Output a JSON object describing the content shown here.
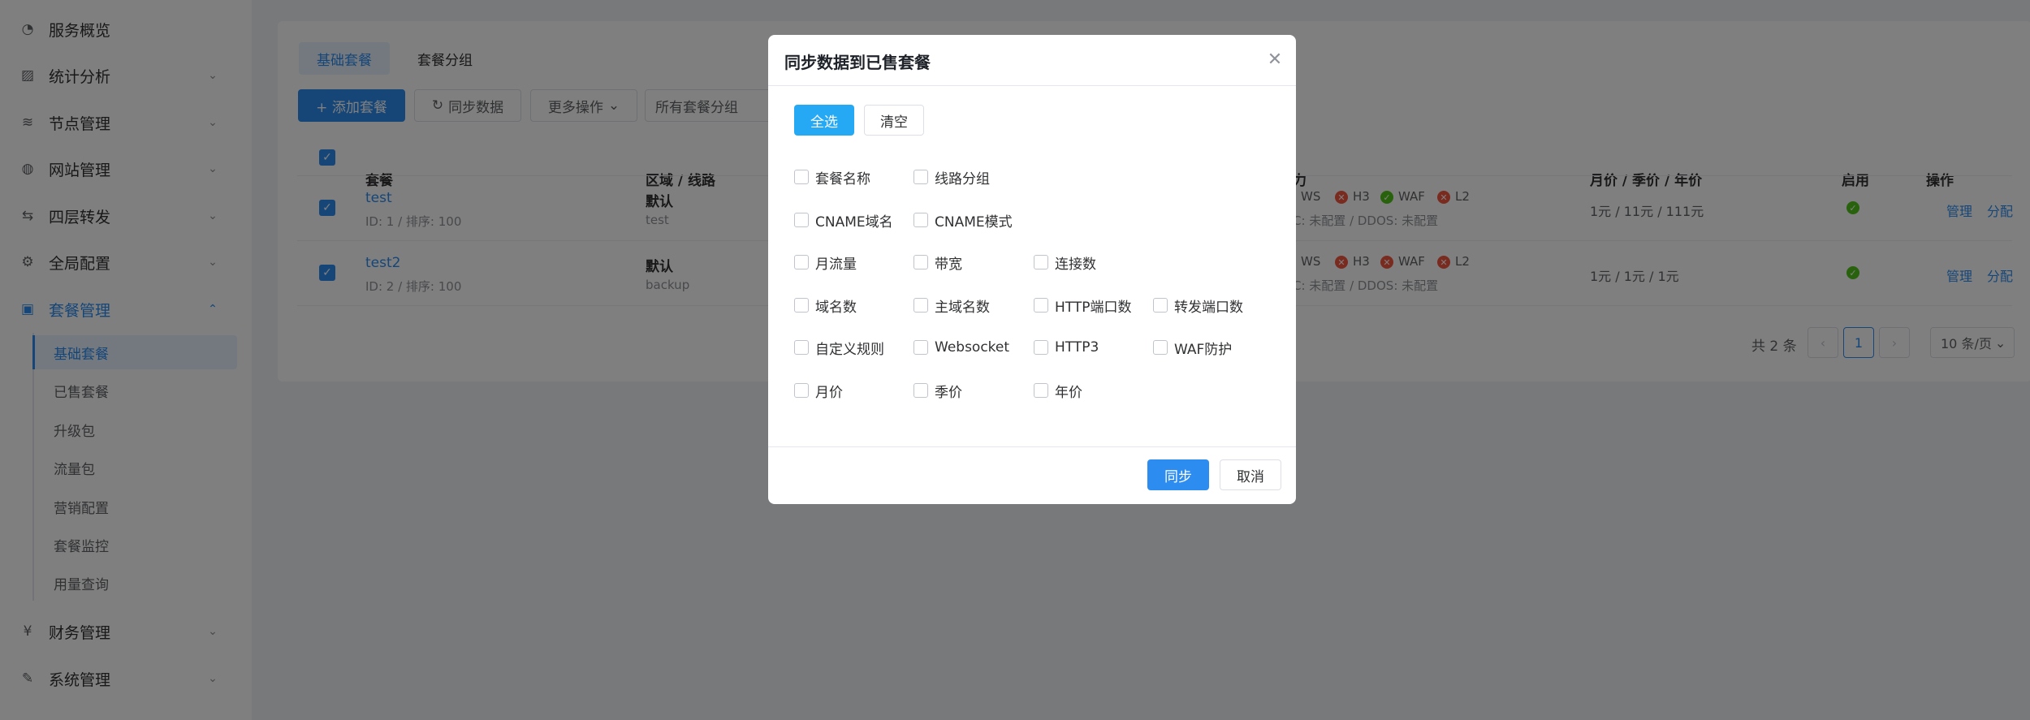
{
  "sidebar": {
    "items": [
      {
        "icon": "dashboard-icon",
        "label": "服务概览",
        "arrow": false
      },
      {
        "icon": "chart-icon",
        "label": "统计分析",
        "arrow": true
      },
      {
        "icon": "layers-icon",
        "label": "节点管理",
        "arrow": true
      },
      {
        "icon": "globe-icon",
        "label": "网站管理",
        "arrow": true
      },
      {
        "icon": "forward-icon",
        "label": "四层转发",
        "arrow": true
      },
      {
        "icon": "gear-icon",
        "label": "全局配置",
        "arrow": true
      },
      {
        "icon": "bag-icon",
        "label": "套餐管理",
        "arrow": true,
        "active": true
      },
      {
        "icon": "yen-icon",
        "label": "财务管理",
        "arrow": true
      },
      {
        "icon": "wrench-icon",
        "label": "系统管理",
        "arrow": true
      }
    ],
    "sub_items": [
      "基础套餐",
      "已售套餐",
      "升级包",
      "流量包",
      "营销配置",
      "套餐监控",
      "用量查询"
    ]
  },
  "main": {
    "tabs": [
      "基础套餐",
      "套餐分组"
    ],
    "toolbar": {
      "add": "+ 添加套餐",
      "sync": "同步数据",
      "more": "更多操作",
      "group_select": "所有套餐分组"
    },
    "columns": {
      "plan": "套餐",
      "region": "区域 / 线路",
      "ability": "力",
      "price": "月价 / 季价 / 年价",
      "enabled": "启用",
      "ops": "操作"
    },
    "rows": [
      {
        "name": "test",
        "meta": "ID: 1 / 排序: 100",
        "region": "默认",
        "line": "test",
        "caps": [
          "WS",
          "H3",
          "WAF",
          "L2"
        ],
        "cap_sub": "C: 未配置 / DDOS: 未配置",
        "price": "1元 / 11元 / 111元",
        "op1": "管理",
        "op2": "分配"
      },
      {
        "name": "test2",
        "meta": "ID: 2 / 排序: 100",
        "region": "默认",
        "line": "backup",
        "caps": [
          "WS",
          "H3",
          "WAF",
          "L2"
        ],
        "cap_sub": "C: 未配置 / DDOS: 未配置",
        "price": "1元 / 1元 / 1元",
        "op1": "管理",
        "op2": "分配"
      }
    ],
    "pager": {
      "total": "共 2 条",
      "page": "1",
      "size": "10 条/页"
    }
  },
  "modal": {
    "title": "同步数据到已售套餐",
    "select_all": "全选",
    "clear": "清空",
    "options": [
      [
        "套餐名称",
        "线路分组"
      ],
      [
        "CNAME域名",
        "CNAME模式"
      ],
      [
        "月流量",
        "带宽",
        "连接数"
      ],
      [
        "域名数",
        "主域名数",
        "HTTP端口数",
        "转发端口数"
      ],
      [
        "自定义规则",
        "Websocket",
        "HTTP3",
        "WAF防护"
      ],
      [
        "月价",
        "季价",
        "年价"
      ]
    ],
    "sync": "同步",
    "cancel": "取消"
  },
  "colors": {
    "accent": "#2d8cf0",
    "select_all": "#26a9f5",
    "ok": "#52c41a",
    "err": "#f5563f"
  }
}
